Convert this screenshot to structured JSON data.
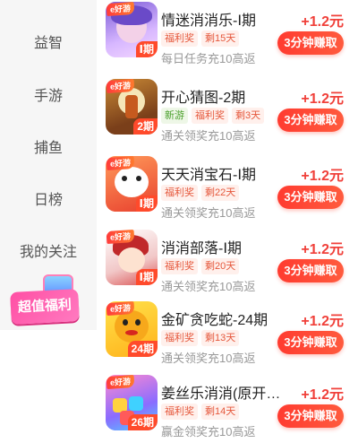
{
  "sidebar": {
    "items": [
      {
        "label": "益智"
      },
      {
        "label": "手游"
      },
      {
        "label": "捕鱼"
      },
      {
        "label": "日榜"
      },
      {
        "label": "我的关注"
      }
    ],
    "promo_label": "超值福利"
  },
  "games": [
    {
      "tag": "e好游",
      "period": "Ⅰ期",
      "title": "情迷消消乐-Ⅰ期",
      "reward": "+1.2元",
      "badges": [
        "福利奖",
        "剩15天"
      ],
      "desc": "每日任务充10高返",
      "button": "3分钟赚取"
    },
    {
      "tag": "e好游",
      "period": "2期",
      "title": "开心猜图-2期",
      "reward": "+1.2元",
      "badges": [
        "新游",
        "福利奖",
        "剩3天"
      ],
      "desc": "通关领奖充10高返",
      "button": "3分钟赚取"
    },
    {
      "tag": "e好游",
      "period": "Ⅰ期",
      "title": "天天消宝石-Ⅰ期",
      "reward": "+1.2元",
      "badges": [
        "福利奖",
        "剩22天"
      ],
      "desc": "通关领奖充10高返",
      "button": "3分钟赚取"
    },
    {
      "tag": "e好游",
      "period": "Ⅰ期",
      "title": "消消部落-Ⅰ期",
      "reward": "+1.2元",
      "badges": [
        "福利奖",
        "剩20天"
      ],
      "desc": "通关领奖充10高返",
      "button": "3分钟赚取"
    },
    {
      "tag": "e好游",
      "period": "24期",
      "title": "金矿贪吃蛇-24期",
      "reward": "+1.2元",
      "badges": [
        "福利奖",
        "剩13天"
      ],
      "desc": "通关领奖充10高返",
      "button": "3分钟赚取"
    },
    {
      "tag": "e好游",
      "period": "26期",
      "title": "姜丝乐消消(原开…",
      "reward": "+1.2元",
      "badges": [
        "福利奖",
        "剩14天"
      ],
      "desc": "赢金领奖充10高返",
      "button": "3分钟赚取"
    }
  ],
  "colors": {
    "accent": "#ff3b30",
    "reward": "#f0403a",
    "promo": "#ff4fa4"
  }
}
